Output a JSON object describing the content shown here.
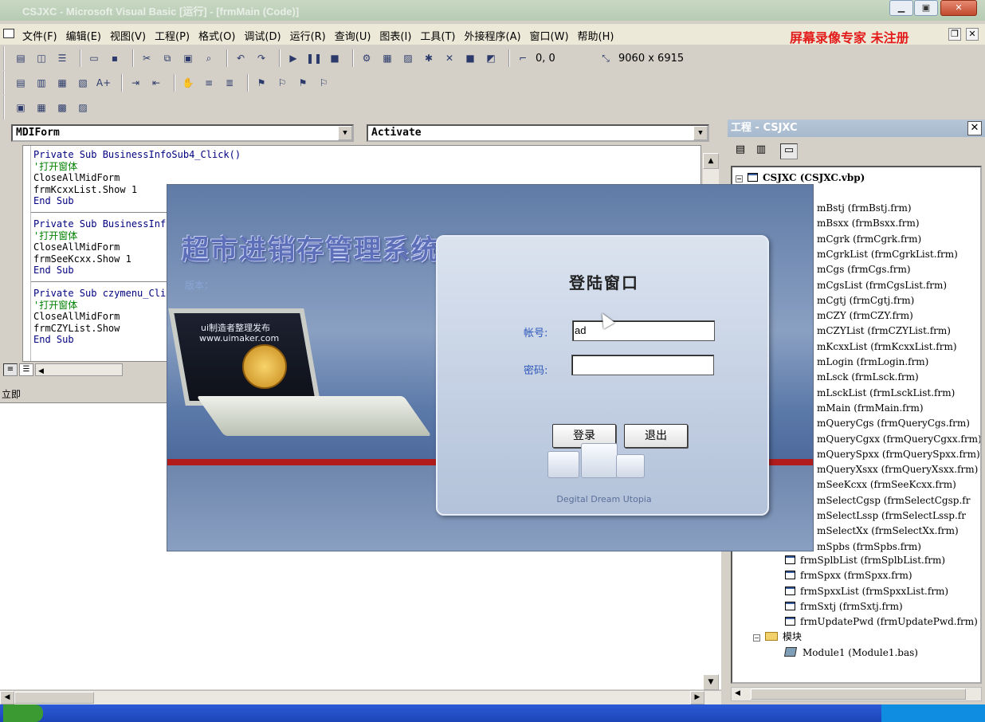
{
  "window": {
    "title": "CSJXC - Microsoft Visual Basic [运行] - [frmMain (Code)]"
  },
  "menubar": {
    "items": [
      "文件(F)",
      "编辑(E)",
      "视图(V)",
      "工程(P)",
      "格式(O)",
      "调试(D)",
      "运行(R)",
      "查询(U)",
      "图表(I)",
      "工具(T)",
      "外接程序(A)",
      "窗口(W)",
      "帮助(H)"
    ],
    "registration_notice": "屏幕录像专家 未注册"
  },
  "toolbar": {
    "position_readout": "0, 0",
    "size_readout": "9060 x 6915"
  },
  "code_window": {
    "object_combo": "MDIForm",
    "procedure_combo": "Activate",
    "blocks": [
      {
        "lines": [
          {
            "kind": "kw",
            "text": "Private Sub BusinessInfoSub4_Click()"
          },
          {
            "kind": "cm",
            "text": "'打开窗体"
          },
          {
            "kind": "code",
            "text": "CloseAllMidForm"
          },
          {
            "kind": "code",
            "text": "frmKcxxList.Show 1"
          },
          {
            "kind": "kw",
            "text": "End Sub"
          }
        ]
      },
      {
        "lines": [
          {
            "kind": "kw",
            "text": "Private Sub BusinessInf"
          },
          {
            "kind": "cm",
            "text": "'打开窗体"
          },
          {
            "kind": "code",
            "text": "CloseAllMidForm"
          },
          {
            "kind": "code",
            "text": "frmSeeKcxx.Show 1"
          },
          {
            "kind": "kw",
            "text": "End Sub"
          }
        ]
      },
      {
        "lines": [
          {
            "kind": "kw",
            "text": "Private Sub czymenu_Cli"
          },
          {
            "kind": "cm",
            "text": "'打开窗体"
          },
          {
            "kind": "code",
            "text": "CloseAllMidForm"
          },
          {
            "kind": "code",
            "text": "frmCZYList.Show"
          },
          {
            "kind": "kw",
            "text": "End Sub"
          }
        ]
      }
    ]
  },
  "immediate_window": {
    "title": "立即"
  },
  "project_explorer": {
    "title": "工程 - CSJXC",
    "root": "CSJXC (CSJXC.vbp)",
    "forms": [
      "mBstj (frmBstj.frm)",
      "mBsxx (frmBsxx.frm)",
      "mCgrk (frmCgrk.frm)",
      "mCgrkList (frmCgrkList.frm)",
      "mCgs (frmCgs.frm)",
      "mCgsList (frmCgsList.frm)",
      "mCgtj (frmCgtj.frm)",
      "mCZY (frmCZY.frm)",
      "mCZYList (frmCZYList.frm)",
      "mKcxxList (frmKcxxList.frm)",
      "mLogin (frmLogin.frm)",
      "mLsck (frmLsck.frm)",
      "mLsckList (frmLsckList.frm)",
      "mMain (frmMain.frm)",
      "mQueryCgs (frmQueryCgs.frm)",
      "mQueryCgxx (frmQueryCgxx.frm)",
      "mQuerySpxx (frmQuerySpxx.frm)",
      "mQueryXsxx (frmQueryXsxx.frm)",
      "mSeeKcxx (frmSeeKcxx.frm)",
      "mSelectCgsp (frmSelectCgsp.fr",
      "mSelectLssp (frmSelectLssp.fr",
      "mSelectXx (frmSelectXx.frm)",
      "mSpbs (frmSpbs.frm)"
    ],
    "forms_visible": [
      "frmSplbList (frmSplbList.frm)",
      "frmSpxx (frmSpxx.frm)",
      "frmSpxxList (frmSpxxList.frm)",
      "frmSxtj (frmSxtj.frm)",
      "frmUpdatePwd (frmUpdatePwd.frm)"
    ],
    "modules_folder": "模块",
    "modules": [
      "Module1 (Module1.bas)"
    ]
  },
  "login_app": {
    "system_title": "超市进销存管理系统",
    "subtitle": "版本：",
    "laptop_text_1": "ui制造者整理发布",
    "laptop_text_2": "www.uimaker.com",
    "dialog": {
      "title": "登陆窗口",
      "username_label": "帐号:",
      "username_value": "ad",
      "password_label": "密码:",
      "password_value": "",
      "login_button": "登录",
      "exit_button": "退出",
      "brand": "Degital Dream Utopia"
    }
  }
}
